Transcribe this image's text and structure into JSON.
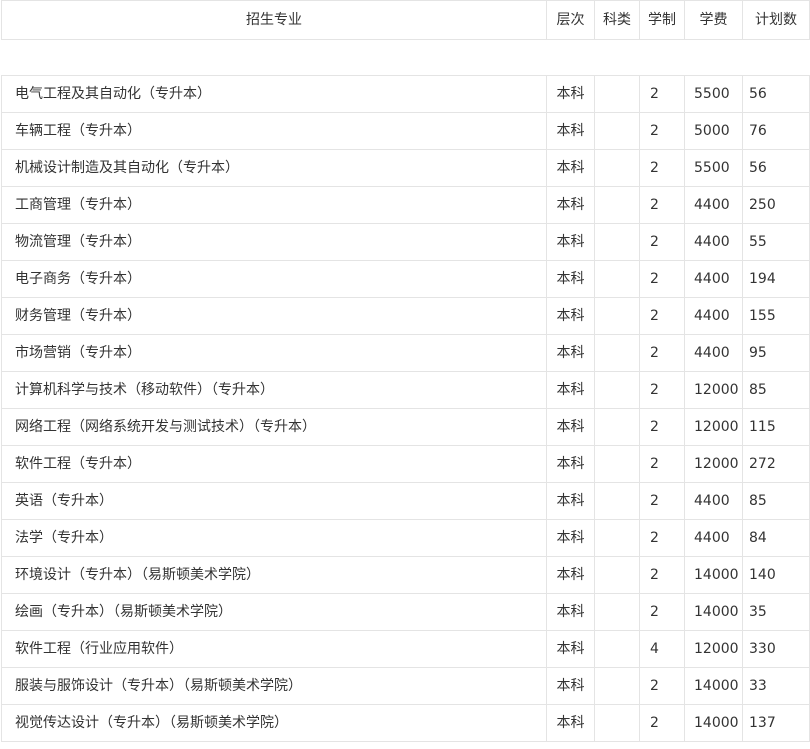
{
  "table": {
    "headers": {
      "major": "招生专业",
      "level": "层次",
      "category": "科类",
      "years": "学制",
      "fee": "学费",
      "plan": "计划数"
    },
    "rows": [
      {
        "major": "电气工程及其自动化（专升本）",
        "level": "本科",
        "category": "",
        "years": "2",
        "fee": "5500",
        "plan": "56"
      },
      {
        "major": "车辆工程（专升本）",
        "level": "本科",
        "category": "",
        "years": "2",
        "fee": "5000",
        "plan": "76"
      },
      {
        "major": "机械设计制造及其自动化（专升本）",
        "level": "本科",
        "category": "",
        "years": "2",
        "fee": "5500",
        "plan": "56"
      },
      {
        "major": "工商管理（专升本）",
        "level": "本科",
        "category": "",
        "years": "2",
        "fee": "4400",
        "plan": "250"
      },
      {
        "major": "物流管理（专升本）",
        "level": "本科",
        "category": "",
        "years": "2",
        "fee": "4400",
        "plan": "55"
      },
      {
        "major": "电子商务（专升本）",
        "level": "本科",
        "category": "",
        "years": "2",
        "fee": "4400",
        "plan": "194"
      },
      {
        "major": "财务管理（专升本）",
        "level": "本科",
        "category": "",
        "years": "2",
        "fee": "4400",
        "plan": "155"
      },
      {
        "major": "市场营销（专升本）",
        "level": "本科",
        "category": "",
        "years": "2",
        "fee": "4400",
        "plan": "95"
      },
      {
        "major": "计算机科学与技术（移动软件）（专升本）",
        "level": "本科",
        "category": "",
        "years": "2",
        "fee": "12000",
        "plan": "85"
      },
      {
        "major": "网络工程（网络系统开发与测试技术）（专升本）",
        "level": "本科",
        "category": "",
        "years": "2",
        "fee": "12000",
        "plan": "115"
      },
      {
        "major": "软件工程（专升本）",
        "level": "本科",
        "category": "",
        "years": "2",
        "fee": "12000",
        "plan": "272"
      },
      {
        "major": "英语（专升本）",
        "level": "本科",
        "category": "",
        "years": "2",
        "fee": "4400",
        "plan": "85"
      },
      {
        "major": "法学（专升本）",
        "level": "本科",
        "category": "",
        "years": "2",
        "fee": "4400",
        "plan": "84"
      },
      {
        "major": "环境设计（专升本）（易斯顿美术学院）",
        "level": "本科",
        "category": "",
        "years": "2",
        "fee": "14000",
        "plan": "140"
      },
      {
        "major": "绘画（专升本）（易斯顿美术学院）",
        "level": "本科",
        "category": "",
        "years": "2",
        "fee": "14000",
        "plan": "35"
      },
      {
        "major": "软件工程（行业应用软件）",
        "level": "本科",
        "category": "",
        "years": "4",
        "fee": "12000",
        "plan": "330"
      },
      {
        "major": "服装与服饰设计（专升本）（易斯顿美术学院）",
        "level": "本科",
        "category": "",
        "years": "2",
        "fee": "14000",
        "plan": "33"
      },
      {
        "major": "视觉传达设计（专升本）（易斯顿美术学院）",
        "level": "本科",
        "category": "",
        "years": "2",
        "fee": "14000",
        "plan": "137"
      }
    ]
  }
}
